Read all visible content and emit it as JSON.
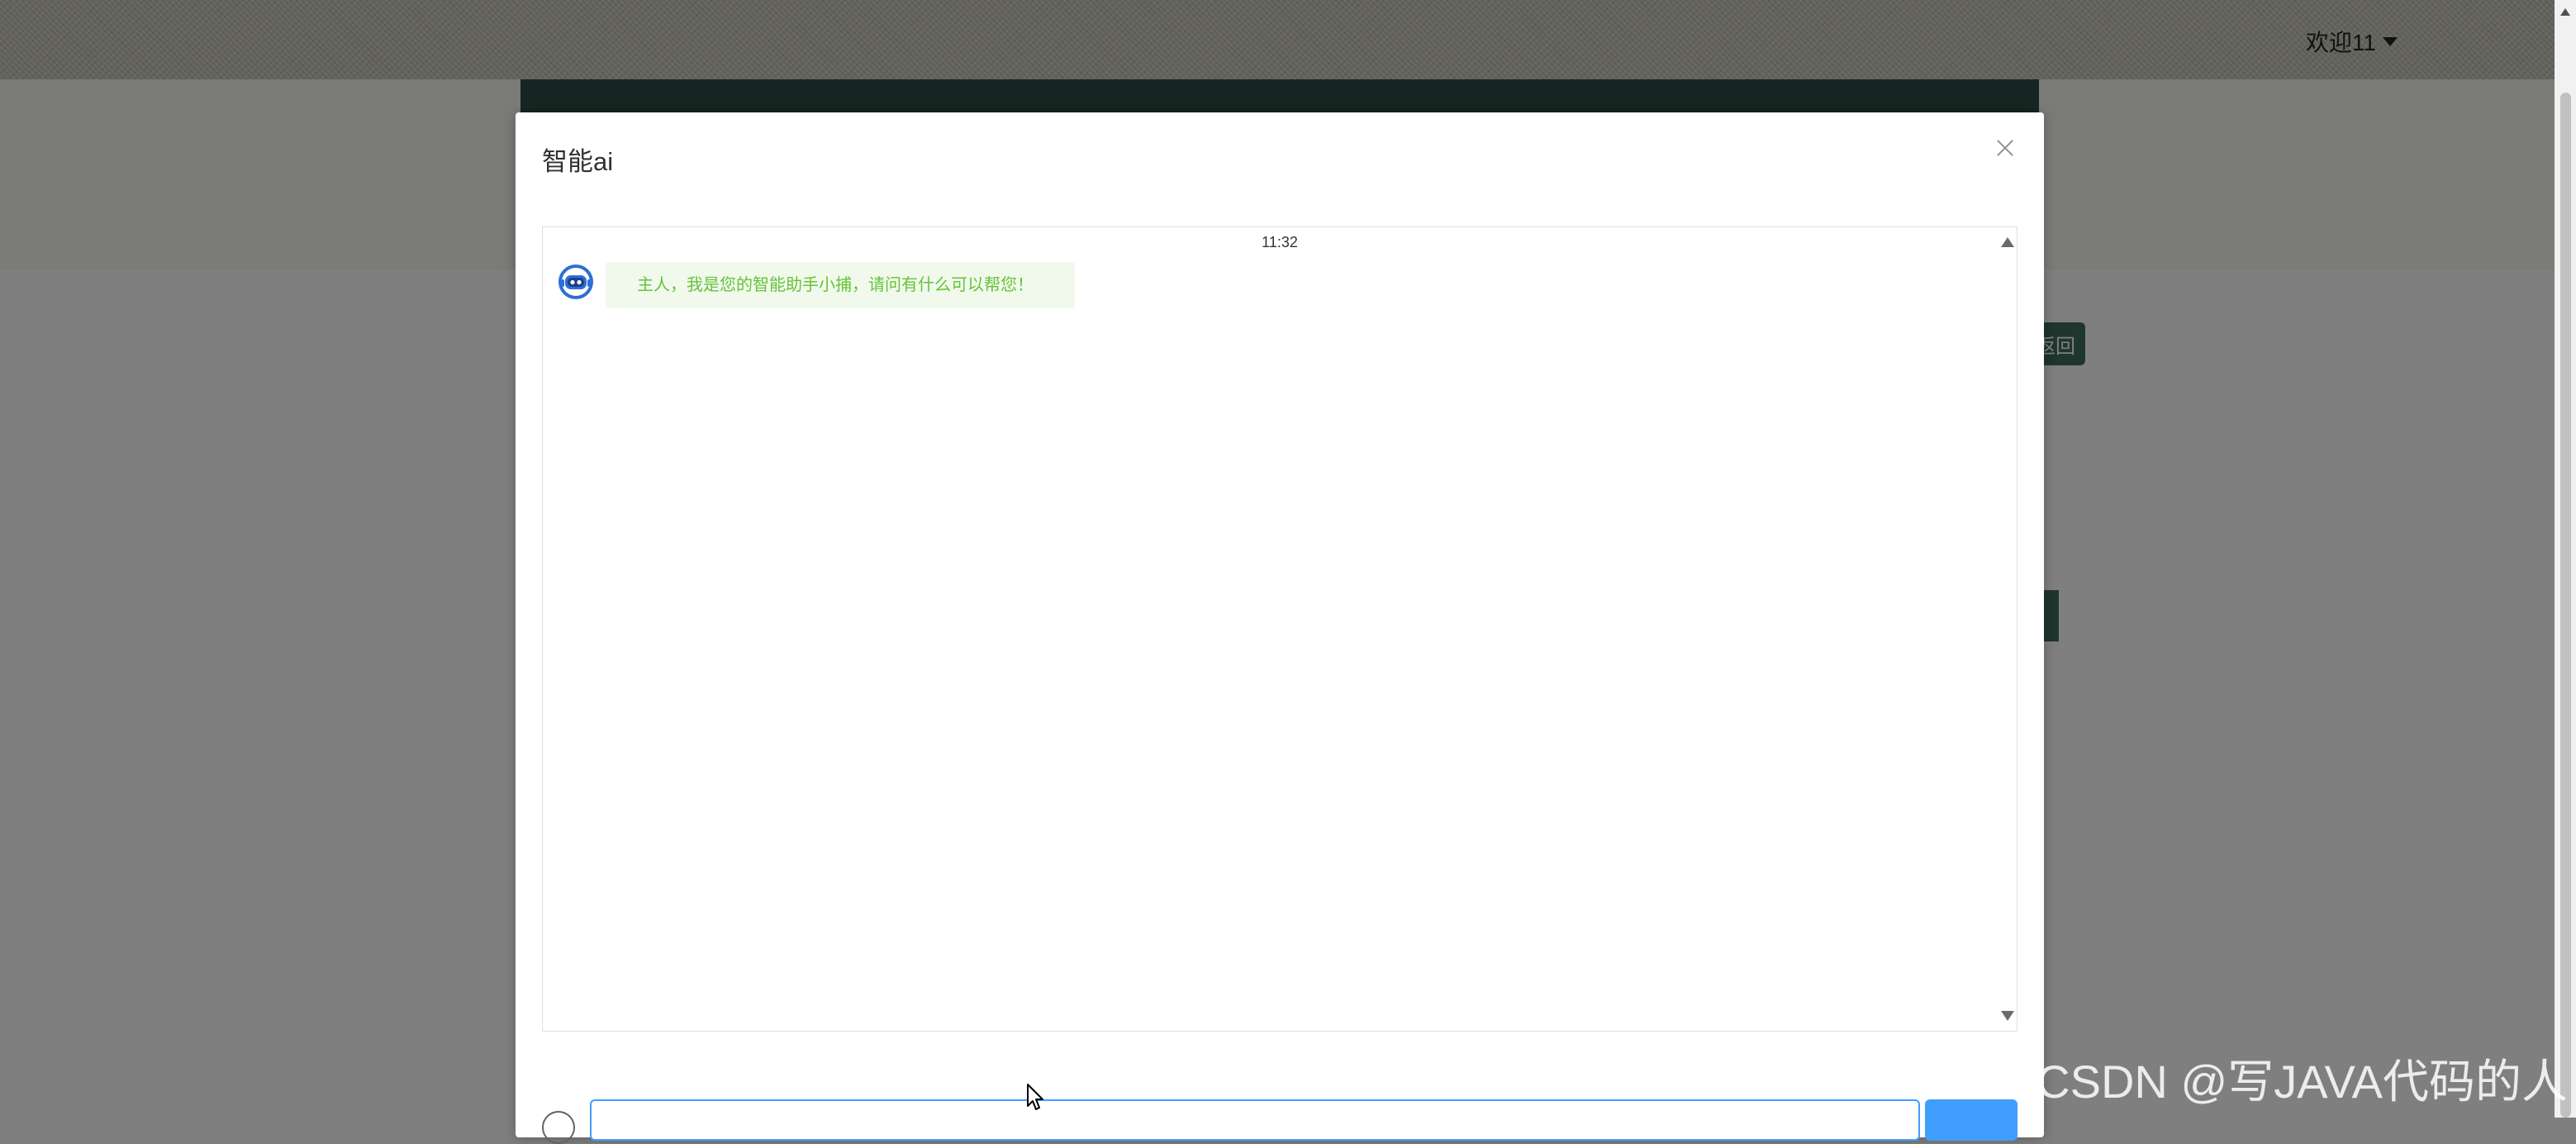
{
  "background": {
    "header": {
      "welcome_text": "欢迎11",
      "menu_icon": "caret-down-icon"
    },
    "side_button_label": "返回"
  },
  "dialog": {
    "title": "智能ai",
    "close_icon": "close-icon",
    "chat": {
      "time": "11:32",
      "messages": [
        {
          "sender": "bot",
          "avatar_icon": "robot-avatar-icon",
          "text": "主人，我是您的智能助手小捕，请问有什么可以帮您！"
        }
      ]
    },
    "input": {
      "value": "",
      "placeholder": ""
    },
    "send_button_label": ""
  },
  "watermark": "CSDN @写JAVA代码的人",
  "colors": {
    "accent": "#409eff",
    "bot_bubble_bg": "#f0f9eb",
    "bot_bubble_text": "#67c23a",
    "header_bar": "#2d4a43"
  }
}
